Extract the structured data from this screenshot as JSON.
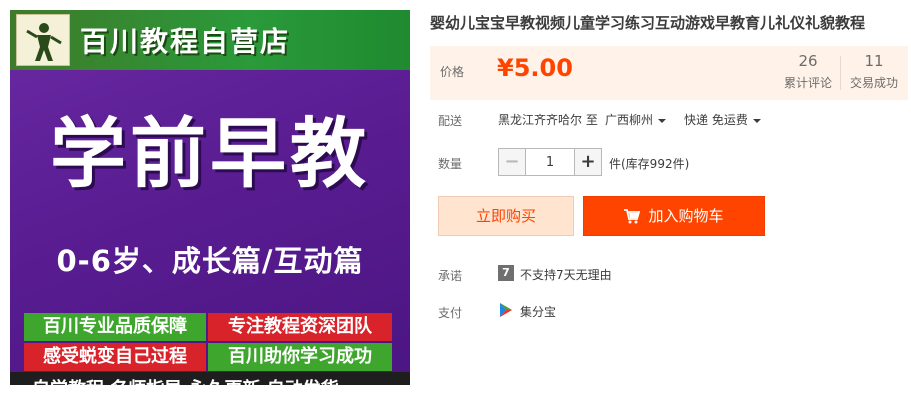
{
  "product_image": {
    "store_name": "百川教程自营店",
    "main_title": "学前早教",
    "sub_title": "0-6岁、成长篇/互动篇",
    "promo": [
      "百川专业品质保障",
      "专注教程资深团队",
      "感受蜕变自己过程",
      "百川助你学习成功"
    ],
    "bottom_strip": "自学教程  名师指导  永久更新  自动发货"
  },
  "product": {
    "title": "婴幼儿宝宝早教视频儿童学习练习互动游戏早教育儿礼仪礼貌教程"
  },
  "price": {
    "label": "价格",
    "value": "¥5.00",
    "reviews_count": "26",
    "reviews_label": "累计评论",
    "sales_count": "11",
    "sales_label": "交易成功"
  },
  "shipping": {
    "label": "配送",
    "from": "黑龙江齐齐哈尔 至",
    "to": "广西柳州",
    "method": "快递 免运费"
  },
  "quantity": {
    "label": "数量",
    "minus": "−",
    "value": "1",
    "plus": "+",
    "stock": "件(库存992件)"
  },
  "actions": {
    "buy_now": "立即购买",
    "add_to_cart": "加入购物车"
  },
  "promise": {
    "label": "承诺",
    "icon_text": "7",
    "text": "不支持7天无理由"
  },
  "payment": {
    "label": "支付",
    "method": "集分宝"
  },
  "colors": {
    "accent": "#ff4400",
    "price_bg": "#fff2e8",
    "buy_now_bg": "#ffe4d0",
    "image_purple": "#5a1d92"
  }
}
